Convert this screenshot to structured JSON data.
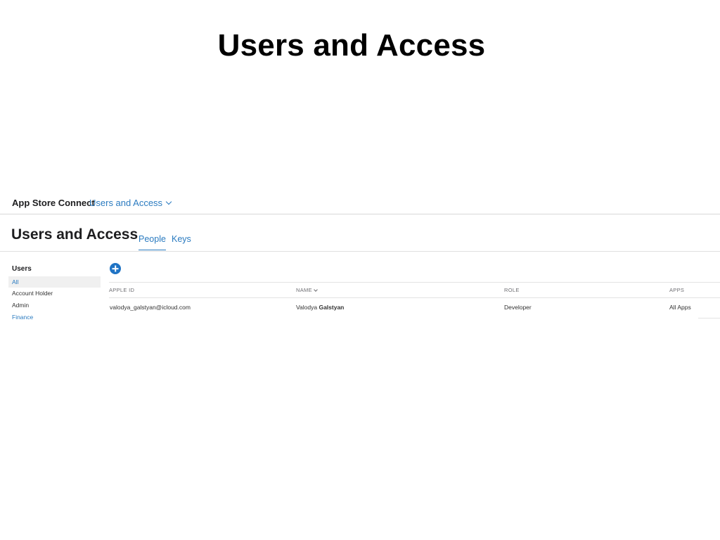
{
  "slide": {
    "title": "Users and Access"
  },
  "topbar": {
    "app_name": "App Store Connect",
    "section_menu_label": "Users and Access"
  },
  "header": {
    "title": "Users and Access",
    "tabs": [
      {
        "label": "People",
        "active": true
      },
      {
        "label": "Keys",
        "active": false
      }
    ]
  },
  "sidebar": {
    "heading": "Users",
    "items": [
      {
        "label": "All",
        "selected": true
      },
      {
        "label": "Account Holder"
      },
      {
        "label": "Admin"
      },
      {
        "label": "Finance"
      }
    ]
  },
  "table": {
    "add_icon": "plus-circle-icon",
    "columns": [
      "APPLE ID",
      "NAME",
      "ROLE",
      "APPS"
    ],
    "rows": [
      {
        "apple_id": "valodya_galstyan@icloud.com",
        "first_name": "Valodya",
        "last_name": "Galstyan",
        "role": "Developer",
        "apps": "All Apps"
      }
    ]
  },
  "colors": {
    "accent": "#2b7bc0",
    "add_button": "#1f73c4",
    "text": "#1d1d1f",
    "muted": "#6e6e73",
    "selected_bg": "#f0f0f0"
  }
}
